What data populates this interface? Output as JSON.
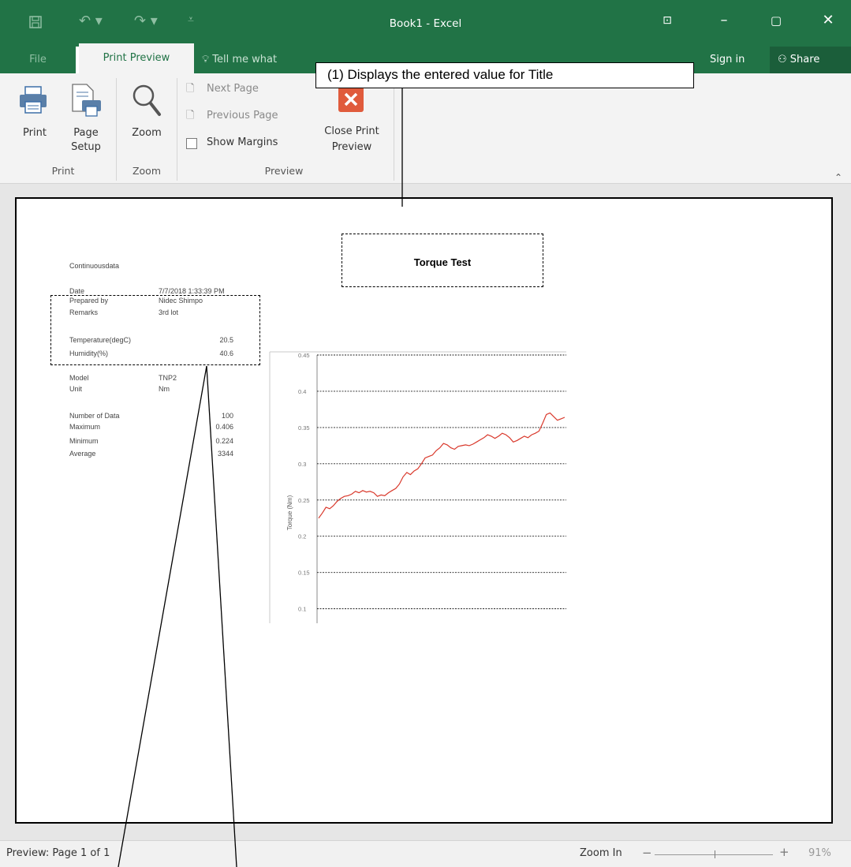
{
  "titlebar": {
    "title": "Book1 - Excel",
    "quick_access": [
      "save-icon",
      "undo-icon",
      "redo-icon",
      "customize-icon"
    ],
    "window_buttons": [
      "ribbon-display-icon",
      "minimize-icon",
      "maximize-icon",
      "close-icon"
    ]
  },
  "tabs": {
    "file": "File",
    "print_preview": "Print Preview",
    "tell_me": "Tell me what",
    "sign_in": "Sign in",
    "share": "Share"
  },
  "ribbon": {
    "print": "Print",
    "page_setup_1": "Page",
    "page_setup_2": "Setup",
    "zoom": "Zoom",
    "next_page": "Next Page",
    "previous_page": "Previous Page",
    "show_margins": "Show Margins",
    "close_preview_1": "Close Print",
    "close_preview_2": "Preview",
    "groups": {
      "print": "Print",
      "zoom": "Zoom",
      "preview": "Preview"
    }
  },
  "callout": {
    "text": "(1) Displays the entered value for Title"
  },
  "sheet": {
    "title": "Torque Test",
    "data_type": "Continuousdata",
    "date_label": "Date",
    "date_value": "7/7/2018 1:33:39 PM",
    "prepared_by_label": "Prepared by",
    "prepared_by_value": "Nidec Shimpo",
    "remarks_label": "Remarks",
    "remarks_value": "3rd lot",
    "temperature_label": "Temperature(degC)",
    "temperature_value": "20.5",
    "humidity_label": "Humidity(%)",
    "humidity_value": "40.6",
    "model_label": "Model",
    "model_value": "TNP2",
    "unit_label": "Unit",
    "unit_value": "Nm",
    "count_label": "Number of Data",
    "count_value": "100",
    "max_label": "Maximum",
    "max_value": "0.406",
    "min_label": "Minimum",
    "min_value": "0.224",
    "avg_label": "Average",
    "avg_value": "3344"
  },
  "chart_data": {
    "type": "line",
    "ylabel": "Torque (Nm)",
    "ylim": [
      0.08,
      0.45
    ],
    "yticks": [
      "0.45",
      "0.4",
      "0.35",
      "0.3",
      "0.25",
      "0.2",
      "0.15",
      "0.1"
    ],
    "grid": true,
    "series": [
      {
        "color": "#d9382b",
        "values": [
          0.225,
          0.232,
          0.24,
          0.238,
          0.242,
          0.248,
          0.252,
          0.255,
          0.256,
          0.258,
          0.262,
          0.26,
          0.263,
          0.261,
          0.262,
          0.26,
          0.255,
          0.257,
          0.256,
          0.26,
          0.263,
          0.266,
          0.272,
          0.282,
          0.288,
          0.285,
          0.29,
          0.293,
          0.3,
          0.308,
          0.31,
          0.312,
          0.318,
          0.322,
          0.328,
          0.326,
          0.322,
          0.32,
          0.324,
          0.325,
          0.326,
          0.325,
          0.327,
          0.33,
          0.333,
          0.336,
          0.34,
          0.338,
          0.335,
          0.338,
          0.342,
          0.34,
          0.336,
          0.33,
          0.332,
          0.335,
          0.338,
          0.336,
          0.34,
          0.342,
          0.345,
          0.356,
          0.368,
          0.37,
          0.365,
          0.36,
          0.362,
          0.364
        ]
      }
    ]
  },
  "status": {
    "page": "Preview: Page 1 of 1",
    "zoom_label": "Zoom In",
    "zoom_pct": "91%"
  }
}
